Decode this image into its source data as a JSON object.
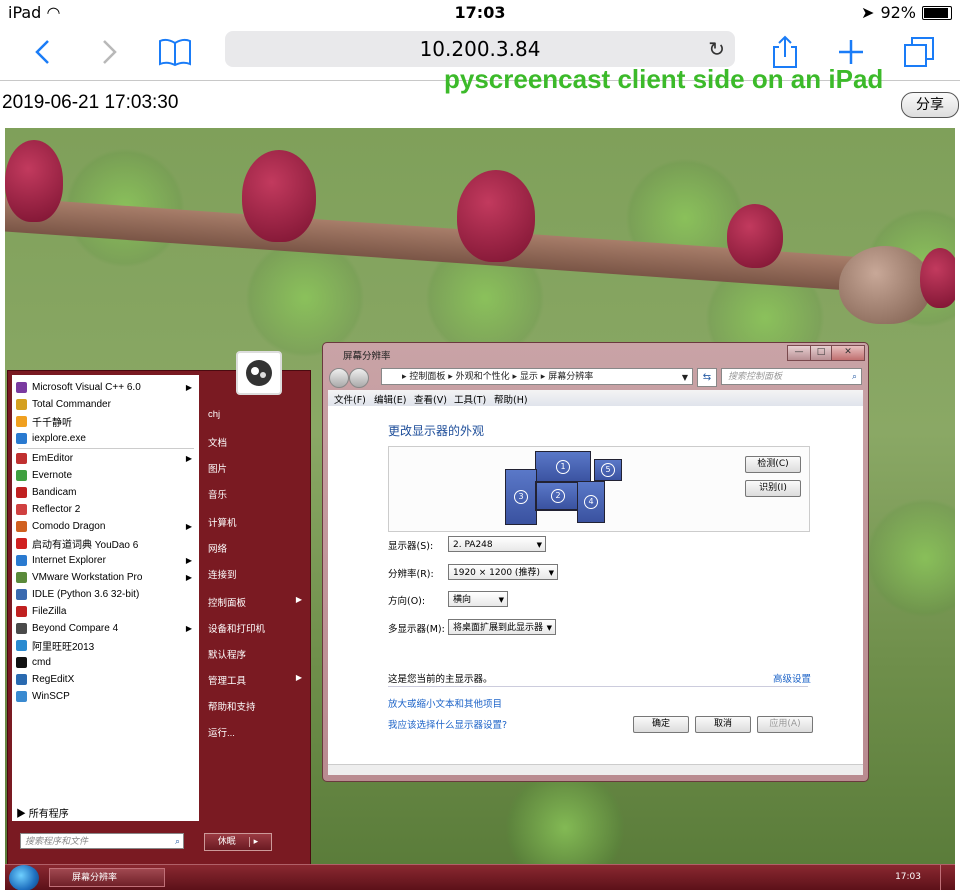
{
  "status_bar": {
    "device": "iPad",
    "time": "17:03",
    "battery": "92%"
  },
  "browser": {
    "url": "10.200.3.84"
  },
  "caption": "pyscreencast client side on an iPad",
  "timestamp": "2019-06-21 17:03:30",
  "share_button": "分享",
  "start_menu": {
    "programs": [
      {
        "label": "Microsoft Visual C++ 6.0",
        "submenu": true,
        "color": "#7a3aa0"
      },
      {
        "label": "Total Commander",
        "submenu": false,
        "color": "#d4a020"
      },
      {
        "label": "千千静听",
        "submenu": false,
        "color": "#f0a020"
      },
      {
        "label": "iexplore.exe",
        "submenu": false,
        "color": "#2a7ad0"
      },
      {
        "label": "EmEditor",
        "submenu": true,
        "color": "#c03030"
      },
      {
        "label": "Evernote",
        "submenu": false,
        "color": "#40a040"
      },
      {
        "label": "Bandicam",
        "submenu": false,
        "color": "#c02020"
      },
      {
        "label": "Reflector 2",
        "submenu": false,
        "color": "#d04040"
      },
      {
        "label": "Comodo Dragon",
        "submenu": true,
        "color": "#d06020"
      },
      {
        "label": "启动有道词典 YouDao 6",
        "submenu": false,
        "color": "#d02020"
      },
      {
        "label": "Internet Explorer",
        "submenu": true,
        "color": "#2a7ad0"
      },
      {
        "label": "VMware Workstation Pro",
        "submenu": true,
        "color": "#5a8a3a"
      },
      {
        "label": "IDLE (Python 3.6 32-bit)",
        "submenu": false,
        "color": "#3a6ab0"
      },
      {
        "label": "FileZilla",
        "submenu": false,
        "color": "#c02020"
      },
      {
        "label": "Beyond Compare 4",
        "submenu": true,
        "color": "#4a4a4a"
      },
      {
        "label": "阿里旺旺2013",
        "submenu": false,
        "color": "#2a8ad0"
      },
      {
        "label": "cmd",
        "submenu": false,
        "color": "#111111"
      },
      {
        "label": "RegEditX",
        "submenu": false,
        "color": "#2a6ab0"
      },
      {
        "label": "WinSCP",
        "submenu": false,
        "color": "#3a8ad0"
      }
    ],
    "all_programs": "所有程序",
    "search_placeholder": "搜索程序和文件",
    "right_items": [
      {
        "label": "chj",
        "submenu": false
      },
      {
        "label": "文档",
        "submenu": false
      },
      {
        "label": "图片",
        "submenu": false
      },
      {
        "label": "音乐",
        "submenu": false
      },
      {
        "label": "计算机",
        "submenu": false
      },
      {
        "label": "网络",
        "submenu": false
      },
      {
        "label": "连接到",
        "submenu": false
      },
      {
        "label": "控制面板",
        "submenu": true
      },
      {
        "label": "设备和打印机",
        "submenu": false
      },
      {
        "label": "默认程序",
        "submenu": false
      },
      {
        "label": "管理工具",
        "submenu": true
      },
      {
        "label": "帮助和支持",
        "submenu": false
      },
      {
        "label": "运行...",
        "submenu": false
      }
    ],
    "shutdown": "休眠"
  },
  "taskbar": {
    "task_label": "屏幕分辨率",
    "clock": "17:03"
  },
  "dialog": {
    "title": "屏幕分辨率",
    "breadcrumb": [
      "控制面板",
      "外观和个性化",
      "显示",
      "屏幕分辨率"
    ],
    "search_placeholder": "搜索控制面板",
    "menu": [
      "文件(F)",
      "编辑(E)",
      "查看(V)",
      "工具(T)",
      "帮助(H)"
    ],
    "heading": "更改显示器的外观",
    "monitors": [
      "1",
      "2",
      "3",
      "4",
      "5"
    ],
    "detect": "检测(C)",
    "identify": "识别(I)",
    "fields": [
      {
        "label": "显示器(S):",
        "value": "2. PA248"
      },
      {
        "label": "分辨率(R):",
        "value": "1920 × 1200 (推荐)"
      },
      {
        "label": "方向(O):",
        "value": "横向"
      },
      {
        "label": "多显示器(M):",
        "value": "将桌面扩展到此显示器"
      }
    ],
    "info": "这是您当前的主显示器。",
    "advanced": "高级设置",
    "links": [
      "放大或缩小文本和其他项目",
      "我应该选择什么显示器设置?"
    ],
    "buttons": {
      "ok": "确定",
      "cancel": "取消",
      "apply": "应用(A)"
    }
  }
}
